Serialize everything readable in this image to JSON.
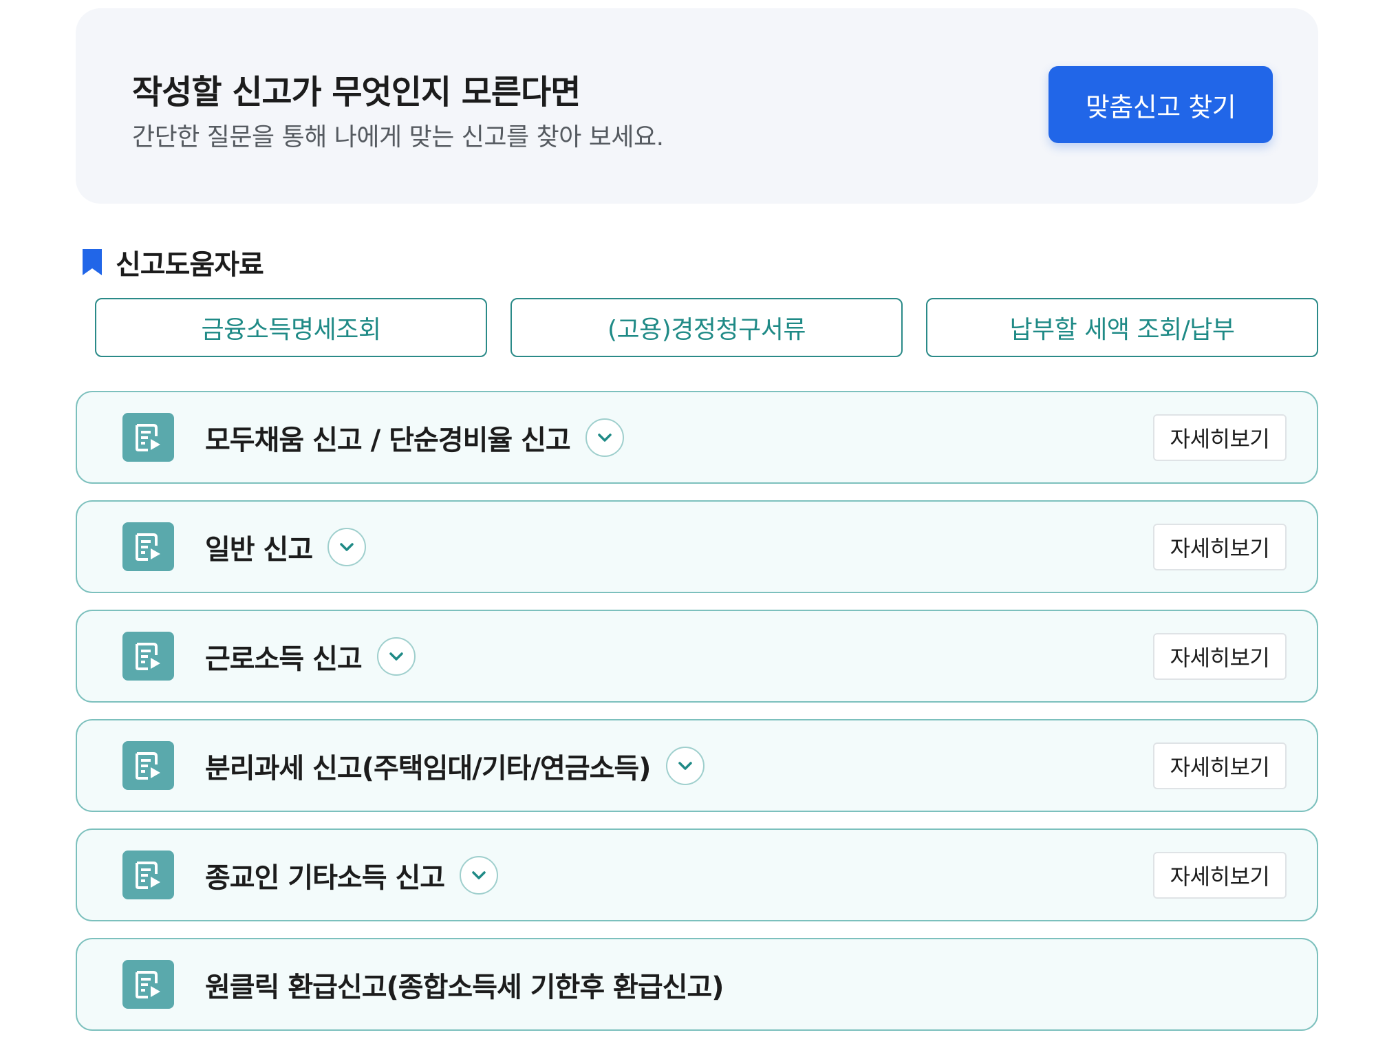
{
  "hero": {
    "title": "작성할 신고가 무엇인지 모른다면",
    "subtitle": "간단한 질문을 통해 나에게 맞는 신고를 찾아 보세요.",
    "button_label": "맞춤신고 찾기",
    "accent_color": "#2166e8"
  },
  "help_section": {
    "title": "신고도움자료",
    "icon": "bookmark-icon",
    "buttons": [
      {
        "label": "금융소득명세조회"
      },
      {
        "label": "(고용)경정청구서류"
      },
      {
        "label": "납부할 세액 조회/납부"
      }
    ]
  },
  "reports": [
    {
      "title": "모두채움 신고 / 단순경비율 신고",
      "detail_label": "자세히보기",
      "icon": "document-edit-icon",
      "expandable": true
    },
    {
      "title": "일반 신고",
      "detail_label": "자세히보기",
      "icon": "document-edit-icon",
      "expandable": true
    },
    {
      "title": "근로소득 신고",
      "detail_label": "자세히보기",
      "icon": "document-edit-icon",
      "expandable": true
    },
    {
      "title": "분리과세 신고(주택임대/기타/연금소득)",
      "detail_label": "자세히보기",
      "icon": "document-edit-icon",
      "expandable": true
    },
    {
      "title": "종교인 기타소득 신고",
      "detail_label": "자세히보기",
      "icon": "document-edit-icon",
      "expandable": true
    },
    {
      "title": "원클릭 환급신고(종합소득세 기한후 환급신고)",
      "icon": "document-edit-icon",
      "expandable": false
    }
  ],
  "colors": {
    "teal_border": "#7cc0bd",
    "teal_text": "#1f8a86",
    "icon_bg": "#5aa9ac",
    "card_bg": "#f3fbfb"
  }
}
